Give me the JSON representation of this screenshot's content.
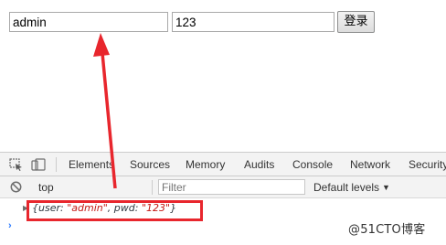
{
  "form": {
    "username_value": "admin",
    "password_value": "123",
    "login_label": "登录"
  },
  "devtools": {
    "tabs": [
      "Elements",
      "Sources",
      "Memory",
      "Audits",
      "Console",
      "Network",
      "Security"
    ],
    "active_tab": "Console",
    "context": "top",
    "filter_placeholder": "Filter",
    "levels_label": "Default levels"
  },
  "console": {
    "message_prefix": "{user: ",
    "user_value": "\"admin\"",
    "middle": ", pwd: ",
    "pwd_value": "\"123\"",
    "suffix": "}"
  },
  "watermark": "@51CTO博客",
  "colors": {
    "annotation_red": "#e8262d",
    "string_red": "#c41a16",
    "devtools_bg": "#f3f3f3"
  }
}
